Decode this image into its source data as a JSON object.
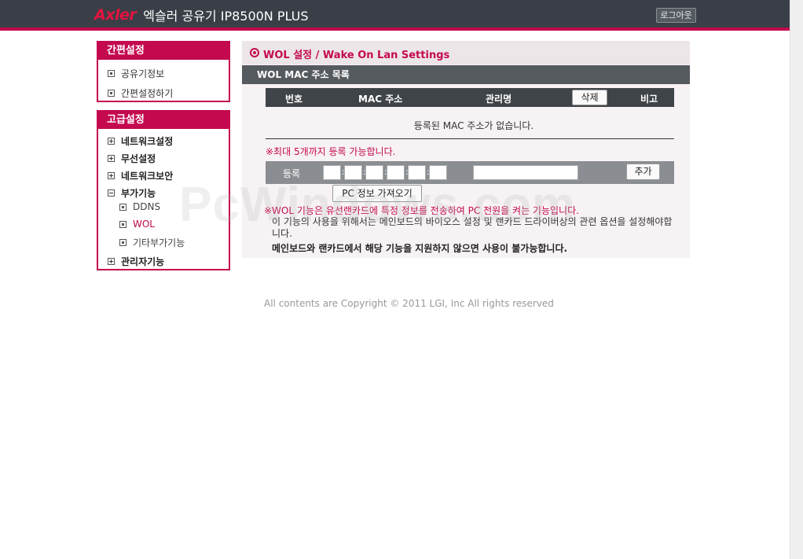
{
  "header": {
    "brand": "Axler",
    "product_title": "엑슬러 공유기 IP8500N PLUS",
    "logout_label": "로그아웃"
  },
  "sidebar": {
    "simple": {
      "title": "간편설정",
      "items": [
        "공유기정보",
        "간편설정하기"
      ]
    },
    "advanced": {
      "title": "고급설정",
      "items": [
        "네트워크설정",
        "무선설정",
        "네트워크보안",
        "부가기능",
        "DDNS",
        "WOL",
        "기타부가기능",
        "관리자기능"
      ]
    }
  },
  "main": {
    "title": "WOL 설정 / Wake On Lan Settings",
    "section_title": "WOL MAC 주소 목록",
    "columns": [
      "번호",
      "MAC 주소",
      "관리명",
      "비고"
    ],
    "delete_label": "삭제",
    "empty_message": "등록된 MAC 주소가 없습니다.",
    "limit_message": "※최대 5개까지 등록 가능합니다.",
    "register_label": "등록",
    "add_label": "추가",
    "pc_info_label": "PC 정보 가져오기",
    "note_line1": "※WOL 기능은 유선랜카드에 특정 정보를 전송하여 PC 전원을 켜는 기능입니다.",
    "note_line2": "이 기능의 사용을 위해서는 메인보드의 바이오스 설정 및 랜카드 드라이버상의 관련 옵션을 설정해야합니다.",
    "note_line3": "메인보드와 랜카드에서 해당 기능을 지원하지 않으면 사용이 불가능합니다."
  },
  "footer": {
    "copyright": "All contents are Copyright © 2011 LGI, Inc All rights reserved"
  },
  "watermark": "PcWindows.com",
  "colors": {
    "accent": "#c4094f",
    "topbar": "#3a3f47",
    "table_header": "#3f4448"
  }
}
